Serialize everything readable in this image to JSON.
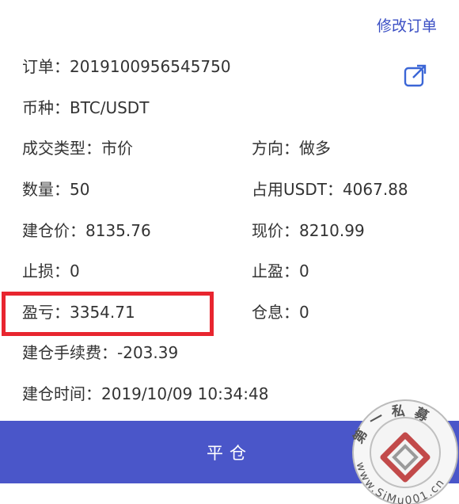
{
  "header": {
    "modify_order": "修改订单"
  },
  "order": {
    "order_no": "订单：2019100956545750",
    "symbol": "币种：BTC/USDT",
    "trade_type": "成交类型：市价",
    "direction": "方向：做多",
    "quantity": "数量：50",
    "margin_used": "占用USDT：4067.88",
    "open_price": "建仓价：8135.76",
    "current_price": "现价：8210.99",
    "stop_loss": "止损：0",
    "take_profit": "止盈：0",
    "pnl": "盈亏：3354.71",
    "overnight_fee": "仓息：0",
    "open_fee": "建仓手续费：-203.39",
    "open_time": "建仓时间：2019/10/09 10:34:48"
  },
  "actions": {
    "close_position": "平仓"
  },
  "watermark": {
    "brand": "第一私募",
    "site": "www.SiMu001.cn"
  },
  "colors": {
    "accent": "#4a56c9",
    "link": "#3b4fc4",
    "highlight": "#e8252f"
  }
}
